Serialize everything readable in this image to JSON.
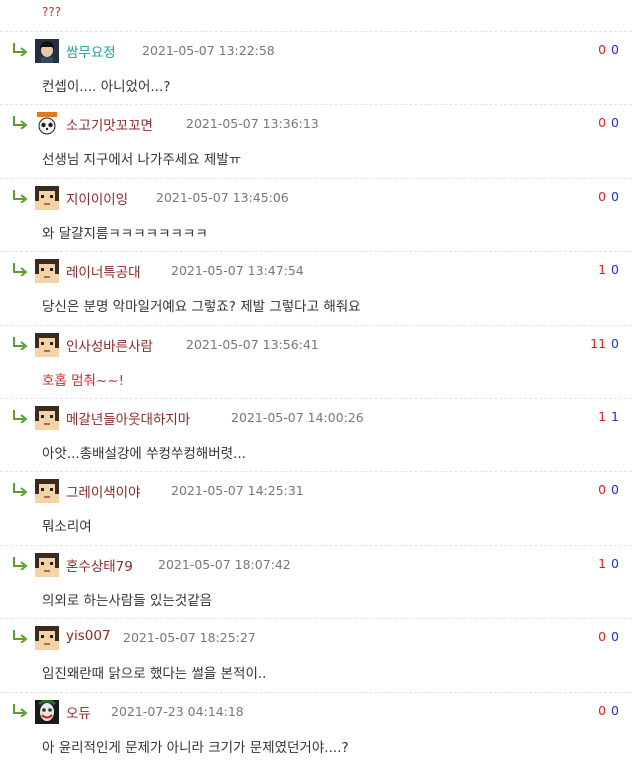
{
  "prev_comment_tail": "???",
  "colors": {
    "upvote": "#e02020",
    "downvote": "#2030d0",
    "red_text": "#d03030"
  },
  "comments": [
    {
      "nick": "쌈무요정",
      "date": "2021-05-07 13:22:58",
      "up": "0",
      "down": "0",
      "text": "컨셉이.... 아니었어...?",
      "nick_color": "#1aa0a0",
      "avatar": "photo-avatar"
    },
    {
      "nick": "소고기맛꼬꼬면",
      "date": "2021-05-07 13:36:13",
      "up": "0",
      "down": "0",
      "text": "선생님 지구에서 나가주세요 제발ㅠ",
      "nick_color": "#8a2a2a",
      "avatar": "panda-avatar"
    },
    {
      "nick": "지이이이잉",
      "date": "2021-05-07 13:45:06",
      "up": "0",
      "down": "0",
      "text": "와 달걀지름ㅋㅋㅋㅋㅋㅋㅋㅋ",
      "nick_color": "#8a2a2a",
      "avatar": "pixel-avatar"
    },
    {
      "nick": "레이너특공대",
      "date": "2021-05-07 13:47:54",
      "up": "1",
      "down": "0",
      "text": "당신은 분명 악마일거예요 그렇죠? 제발 그렇다고 해줘요",
      "nick_color": "#8a2a2a",
      "avatar": "pixel-avatar"
    },
    {
      "nick": "인사성바른사람",
      "date": "2021-05-07 13:56:41",
      "up": "11",
      "down": "0",
      "text": "호홉 멈춰~~!",
      "nick_color": "#8a2a2a",
      "avatar": "pixel-avatar",
      "text_red": true
    },
    {
      "nick": "메갈년들아웃대하지마",
      "date": "2021-05-07 14:00:26",
      "up": "1",
      "down": "1",
      "text": "아앗...총배설강에 쑤컹쑤컹해버렷...",
      "nick_color": "#8a2a2a",
      "avatar": "pixel-avatar"
    },
    {
      "nick": "그레이색이야",
      "date": "2021-05-07 14:25:31",
      "up": "0",
      "down": "0",
      "text": "뭐소리여",
      "nick_color": "#8a2a2a",
      "avatar": "pixel-avatar"
    },
    {
      "nick": "혼수상태79",
      "date": "2021-05-07 18:07:42",
      "up": "1",
      "down": "0",
      "text": "의외로 하는사람들 있는것같음",
      "nick_color": "#8a2a2a",
      "avatar": "pixel-avatar"
    },
    {
      "nick": "yis007",
      "date": "2021-05-07 18:25:27",
      "up": "0",
      "down": "0",
      "text": "임진왜란때 닭으로 했다는 썰을 본적이..",
      "nick_color": "#8a2a2a",
      "avatar": "pixel-avatar"
    },
    {
      "nick": "오듀",
      "date": "2021-07-23 04:14:18",
      "up": "0",
      "down": "0",
      "text": "아 윤리적인게 문제가 아니라 크기가 문제였던거야....?",
      "nick_color": "#8a2a2a",
      "avatar": "joker-avatar"
    }
  ]
}
